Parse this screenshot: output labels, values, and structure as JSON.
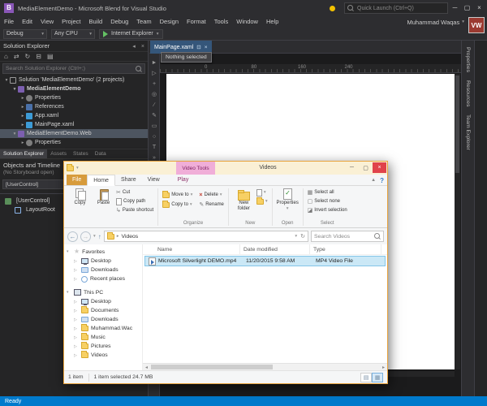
{
  "colors": {
    "accent_blue": "#007ACC",
    "explorer_border": "#E8A33D",
    "selection_blue": "#CBE8F6",
    "video_tools_pink": "#F0AED8"
  },
  "blend": {
    "title": "MediaElementDemo - Microsoft Blend for Visual Studio",
    "quick_launch": "Quick Launch (Ctrl+Q)",
    "user_name": "Muhammad Waqas",
    "avatar_initials": "VW",
    "menus": [
      "File",
      "Edit",
      "View",
      "Project",
      "Build",
      "Debug",
      "Team",
      "Design",
      "Format",
      "Tools",
      "Window",
      "Help"
    ],
    "toolbar": {
      "configuration": "Debug",
      "platform": "Any CPU",
      "run_target": "Internet Explorer"
    },
    "solution_explorer": {
      "title": "Solution Explorer",
      "search_placeholder": "Search Solution Explorer (Ctrl+;)",
      "tree": [
        {
          "label": "Solution 'MediaElementDemo' (2 projects)",
          "level": 0,
          "expander": "▾",
          "icon": "solution"
        },
        {
          "label": "MediaElementDemo",
          "level": 1,
          "expander": "▾",
          "icon": "project",
          "bold": true
        },
        {
          "label": "Properties",
          "level": 2,
          "expander": "▸",
          "icon": "properties"
        },
        {
          "label": "References",
          "level": 2,
          "expander": "▸",
          "icon": "references"
        },
        {
          "label": "App.xaml",
          "level": 2,
          "expander": "▸",
          "icon": "xaml"
        },
        {
          "label": "MainPage.xaml",
          "level": 2,
          "expander": "▸",
          "icon": "xaml"
        },
        {
          "label": "MediaElementDemo.Web",
          "level": 1,
          "expander": "▾",
          "icon": "project",
          "selected": true
        },
        {
          "label": "Properties",
          "level": 2,
          "expander": "▸",
          "icon": "properties"
        }
      ],
      "tabs": [
        {
          "label": "Solution Explorer",
          "active": true
        },
        {
          "label": "Assets"
        },
        {
          "label": "States"
        },
        {
          "label": "Data"
        }
      ]
    },
    "objects_timeline": {
      "title": "Objects and Timeline",
      "subtitle": "(No Storyboard open)",
      "scope_dropdown": "[UserControl]",
      "tree": [
        {
          "label": "[UserControl]",
          "level": 0,
          "icon": "usercontrol"
        },
        {
          "label": "LayoutRoot",
          "level": 1,
          "icon": "grid"
        }
      ]
    },
    "document_tab": "MainPage.xaml",
    "artboard_tooltip": "Nothing selected",
    "ruler_marks": [
      "0",
      "80",
      "160",
      "240"
    ],
    "tools": [
      {
        "name": "selection-tool",
        "glyph": "►"
      },
      {
        "name": "direct-selection-tool",
        "glyph": "▷"
      },
      {
        "name": "pan-tool",
        "glyph": "+"
      },
      {
        "name": "zoom-tool",
        "glyph": "◎"
      },
      {
        "name": "eyedropper-tool",
        "glyph": "∕"
      },
      {
        "name": "pen-tool",
        "glyph": "✎"
      },
      {
        "name": "rectangle-tool",
        "glyph": "▭"
      },
      {
        "name": "ellipse-tool",
        "glyph": "○"
      },
      {
        "name": "text-tool",
        "glyph": "T"
      },
      {
        "name": "assets-tool",
        "glyph": "»"
      }
    ],
    "right_tabs": [
      "Properties",
      "Resources",
      "Team Explorer"
    ],
    "status": "Ready"
  },
  "explorer": {
    "contextual_tab_group": "Video Tools",
    "title": "Videos",
    "tabs": [
      {
        "label": "File",
        "style": "file"
      },
      {
        "label": "Home",
        "style": "active"
      },
      {
        "label": "Share"
      },
      {
        "label": "View"
      },
      {
        "label": "Play",
        "style": "contextual"
      }
    ],
    "ribbon": {
      "copy": "Copy",
      "paste": "Paste",
      "cut": "Cut",
      "copy_path": "Copy path",
      "paste_shortcut": "Paste shortcut",
      "move_to": "Move to",
      "copy_to": "Copy to",
      "delete": "Delete",
      "rename": "Rename",
      "organize": "Organize",
      "new_folder": "New folder",
      "new": "New",
      "properties": "Properties",
      "open": "Open",
      "select_all": "Select all",
      "select_none": "Select none",
      "invert_selection": "Invert selection",
      "select": "Select"
    },
    "address_path": "Videos",
    "search_placeholder": "Search Videos",
    "sidebar": [
      {
        "label": "Favorites",
        "icon": "star",
        "items": [
          {
            "label": "Desktop",
            "icon": "monitor"
          },
          {
            "label": "Downloads",
            "icon": "downloads"
          },
          {
            "label": "Recent places",
            "icon": "recent"
          }
        ]
      },
      {
        "label": "This PC",
        "icon": "pc",
        "items": [
          {
            "label": "Desktop",
            "icon": "monitor"
          },
          {
            "label": "Documents",
            "icon": "folder"
          },
          {
            "label": "Downloads",
            "icon": "downloads"
          },
          {
            "label": "Muhammad.Wac",
            "icon": "folder"
          },
          {
            "label": "Music",
            "icon": "folder"
          },
          {
            "label": "Pictures",
            "icon": "folder"
          },
          {
            "label": "Videos",
            "icon": "folder"
          }
        ]
      }
    ],
    "columns": [
      "Name",
      "Date modified",
      "Type"
    ],
    "files": [
      {
        "name": "Microsoft Silverlight DEMO.mp4",
        "date_modified": "11/20/2015 9:58 AM",
        "type": "MP4 Video File",
        "selected": true
      }
    ],
    "status": {
      "items_count": "1 item",
      "selection": "1 item selected 24.7 MB"
    }
  }
}
